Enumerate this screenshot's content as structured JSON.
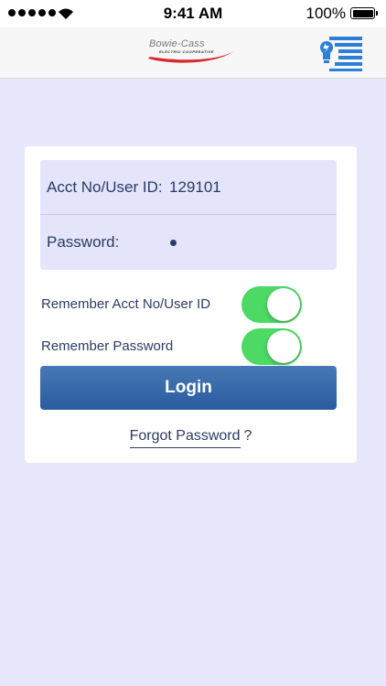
{
  "status_bar": {
    "time": "9:41 AM",
    "battery_percent": "100%",
    "signal_bars": 5,
    "battery_level": 1.0
  },
  "nav": {
    "logo_name": "Bowie-Cass",
    "logo_subtitle": "ELECTRIC COOPERATIVE",
    "menu_icon": "bulb-list-icon"
  },
  "login_form": {
    "acct_label": "Acct No/User ID:",
    "acct_value": "129101",
    "password_label": "Password:",
    "password_masked_length": 1,
    "remember_acct_label": "Remember Acct No/User ID",
    "remember_acct_on": true,
    "remember_password_label": "Remember Password",
    "remember_password_on": true,
    "login_label": "Login",
    "forgot_label": "Forgot Password",
    "forgot_suffix": "?"
  },
  "colors": {
    "background": "#e7e7fb",
    "field_bg": "#e4e4fa",
    "text": "#2a3b66",
    "toggle_on": "#4cd964",
    "button": "#3a6bab",
    "menu_icon": "#2c7fd6",
    "logo_swoosh": "#d8282f"
  }
}
